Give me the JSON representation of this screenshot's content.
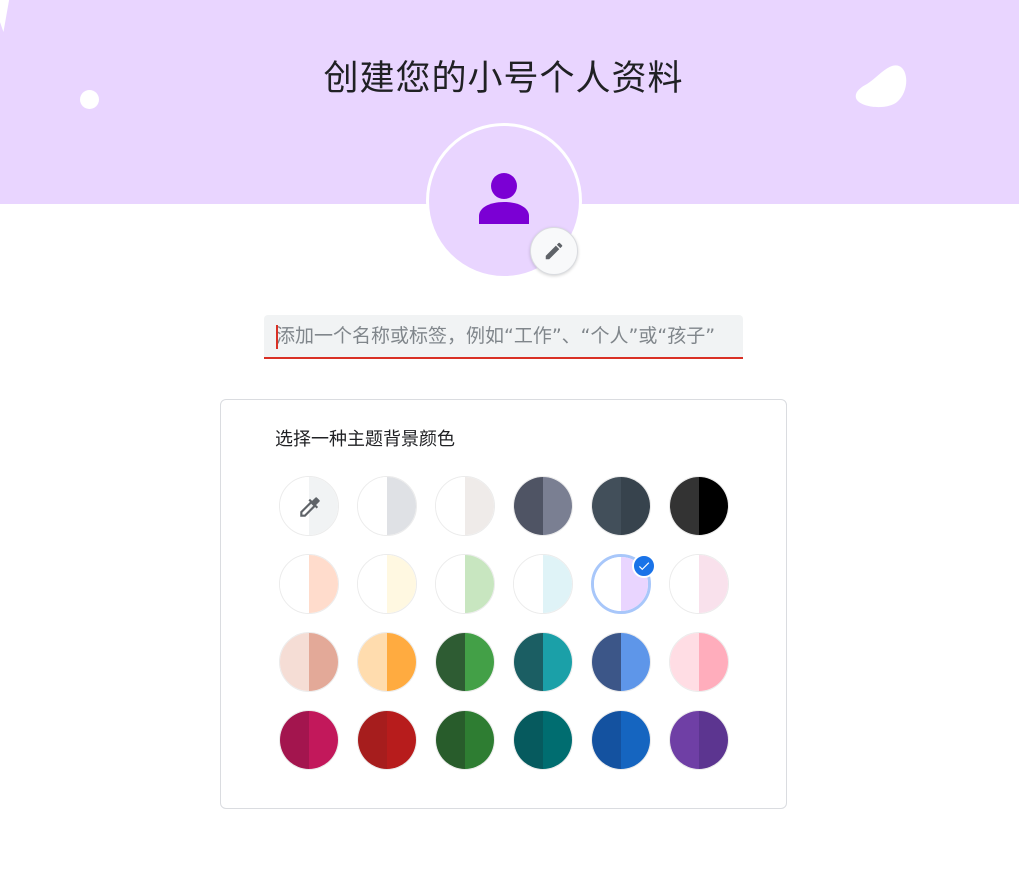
{
  "page": {
    "title": "创建您的小号个人资料"
  },
  "avatar": {
    "icon": "person-icon",
    "edit_icon": "pencil-icon"
  },
  "name_input": {
    "placeholder": "添加一个名称或标签，例如“工作”、“个人”或“孩子”",
    "value": ""
  },
  "theme": {
    "heading": "选择一种主题背景颜色",
    "custom_picker_icon": "eyedropper-icon",
    "selected_index": 10,
    "swatches": [
      {
        "left": "#ffffff",
        "right": "#f1f3f4",
        "custom": true
      },
      {
        "left": "#ffffff",
        "right": "#dfe1e5"
      },
      {
        "left": "#ffffff",
        "right": "#efebe9"
      },
      {
        "left": "#4f5464",
        "right": "#7a7f92"
      },
      {
        "left": "#424f5a",
        "right": "#37434d"
      },
      {
        "left": "#333333",
        "right": "#000000"
      },
      {
        "left": "#ffffff",
        "right": "#ffdccc"
      },
      {
        "left": "#ffffff",
        "right": "#fff8e1"
      },
      {
        "left": "#ffffff",
        "right": "#c8e6c0"
      },
      {
        "left": "#ffffff",
        "right": "#dff3f7"
      },
      {
        "left": "#ffffff",
        "right": "#e9d5ff"
      },
      {
        "left": "#ffffff",
        "right": "#f9e1ec"
      },
      {
        "left": "#f5ddd5",
        "right": "#e3a998"
      },
      {
        "left": "#ffdcae",
        "right": "#ffab40"
      },
      {
        "left": "#2e5c33",
        "right": "#43a047"
      },
      {
        "left": "#1b5e63",
        "right": "#1ba0a8"
      },
      {
        "left": "#3c5688",
        "right": "#5e96e9"
      },
      {
        "left": "#ffdde4",
        "right": "#ffadbc"
      },
      {
        "left": "#a3154e",
        "right": "#c2185b"
      },
      {
        "left": "#a61d1d",
        "right": "#b71c1c"
      },
      {
        "left": "#285c2b",
        "right": "#2e7d32"
      },
      {
        "left": "#065a5e",
        "right": "#006d70"
      },
      {
        "left": "#1452a0",
        "right": "#1565c0"
      },
      {
        "left": "#6f3fa5",
        "right": "#5c3590"
      }
    ]
  },
  "colors": {
    "banner": "#e9d5ff",
    "accent_purple": "#7b00d4",
    "error_underline": "#d93025",
    "selected_check": "#1a73e8"
  }
}
